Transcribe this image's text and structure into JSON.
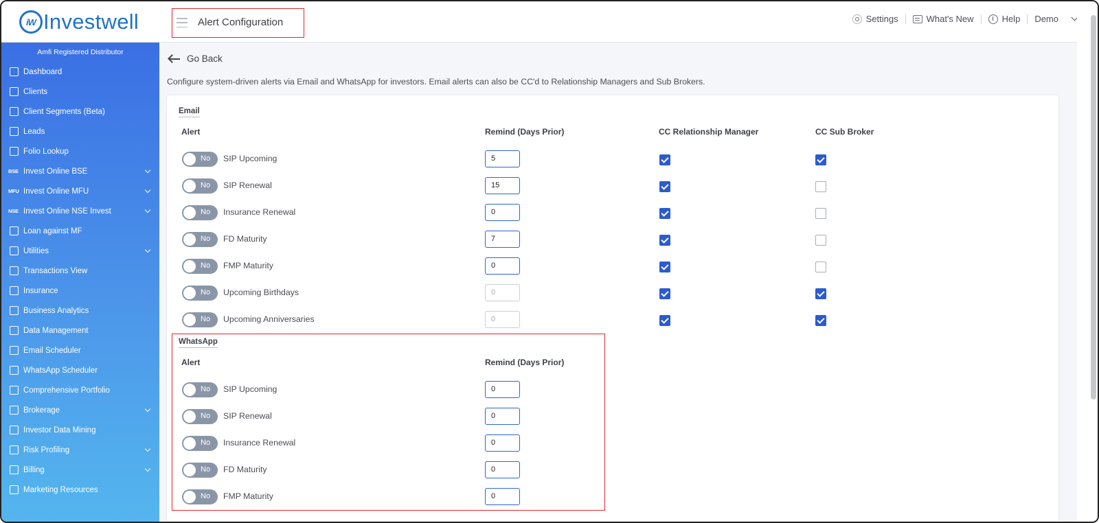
{
  "app": {
    "logo_mark": "iW",
    "logo_text": "Investwell",
    "page_title": "Alert Configuration"
  },
  "topnav": {
    "settings": "Settings",
    "whats_new": "What's New",
    "help": "Help",
    "user": "Demo"
  },
  "sidebar": {
    "header": "Amfi Registered Distributor",
    "items": [
      {
        "label": "Dashboard",
        "icon": "home-icon",
        "expandable": false
      },
      {
        "label": "Clients",
        "icon": "users-icon",
        "expandable": false
      },
      {
        "label": "Client Segments (Beta)",
        "icon": "users-icon",
        "expandable": false
      },
      {
        "label": "Leads",
        "icon": "leads-icon",
        "expandable": false
      },
      {
        "label": "Folio Lookup",
        "icon": "rupee-doc-icon",
        "expandable": false
      },
      {
        "label": "Invest Online BSE",
        "icon": "bse-icon",
        "tag": "BSE",
        "expandable": true
      },
      {
        "label": "Invest Online MFU",
        "icon": "mfu-icon",
        "tag": "MFU",
        "expandable": true
      },
      {
        "label": "Invest Online NSE Invest",
        "icon": "nse-icon",
        "tag": "NSE",
        "expandable": true
      },
      {
        "label": "Loan against MF",
        "icon": "loan-icon",
        "expandable": false
      },
      {
        "label": "Utilities",
        "icon": "utilities-icon",
        "expandable": true
      },
      {
        "label": "Transactions View",
        "icon": "transactions-icon",
        "expandable": false
      },
      {
        "label": "Insurance",
        "icon": "insurance-icon",
        "expandable": false
      },
      {
        "label": "Business Analytics",
        "icon": "analytics-icon",
        "expandable": false
      },
      {
        "label": "Data Management",
        "icon": "data-icon",
        "expandable": false
      },
      {
        "label": "Email Scheduler",
        "icon": "email-icon",
        "expandable": false
      },
      {
        "label": "WhatsApp Scheduler",
        "icon": "whatsapp-icon",
        "expandable": false
      },
      {
        "label": "Comprehensive Portfolio",
        "icon": "portfolio-icon",
        "expandable": false
      },
      {
        "label": "Brokerage",
        "icon": "brokerage-icon",
        "expandable": true
      },
      {
        "label": "Investor Data Mining",
        "icon": "mining-icon",
        "expandable": false
      },
      {
        "label": "Risk Profiling",
        "icon": "risk-icon",
        "expandable": true
      },
      {
        "label": "Billing",
        "icon": "billing-icon",
        "expandable": true
      },
      {
        "label": "Marketing Resources",
        "icon": "marketing-icon",
        "expandable": false
      }
    ]
  },
  "main": {
    "go_back": "Go Back",
    "description": "Configure system-driven alerts via Email and WhatsApp for investors. Email alerts can also be CC'd to Relationship Managers and Sub Brokers.",
    "email": {
      "section": "Email",
      "col_alert": "Alert",
      "col_remind": "Remind (Days Prior)",
      "col_rm": "CC Relationship Manager",
      "col_sb": "CC Sub Broker",
      "rows": [
        {
          "toggle": "No",
          "name": "SIP Upcoming",
          "days": "5",
          "disabled": false,
          "rm": true,
          "sb": true
        },
        {
          "toggle": "No",
          "name": "SIP Renewal",
          "days": "15",
          "disabled": false,
          "rm": true,
          "sb": false
        },
        {
          "toggle": "No",
          "name": "Insurance Renewal",
          "days": "0",
          "disabled": false,
          "rm": true,
          "sb": false
        },
        {
          "toggle": "No",
          "name": "FD Maturity",
          "days": "7",
          "disabled": false,
          "rm": true,
          "sb": false
        },
        {
          "toggle": "No",
          "name": "FMP Maturity",
          "days": "0",
          "disabled": false,
          "rm": true,
          "sb": false
        },
        {
          "toggle": "No",
          "name": "Upcoming Birthdays",
          "days": "0",
          "disabled": true,
          "rm": true,
          "sb": true
        },
        {
          "toggle": "No",
          "name": "Upcoming Anniversaries",
          "days": "0",
          "disabled": true,
          "rm": true,
          "sb": true
        }
      ]
    },
    "whatsapp": {
      "section": "WhatsApp",
      "col_alert": "Alert",
      "col_remind": "Remind (Days Prior)",
      "rows": [
        {
          "toggle": "No",
          "name": "SIP Upcoming",
          "days": "0"
        },
        {
          "toggle": "No",
          "name": "SIP Renewal",
          "days": "0"
        },
        {
          "toggle": "No",
          "name": "Insurance Renewal",
          "days": "0"
        },
        {
          "toggle": "No",
          "name": "FD Maturity",
          "days": "0"
        },
        {
          "toggle": "No",
          "name": "FMP Maturity",
          "days": "0"
        }
      ]
    }
  },
  "colors": {
    "brand": "#1f73c7",
    "sidebar_top": "#3a6fe4",
    "sidebar_bottom": "#54b6ee",
    "checkbox": "#2b5bcf",
    "highlight_box": "#e0262b"
  }
}
